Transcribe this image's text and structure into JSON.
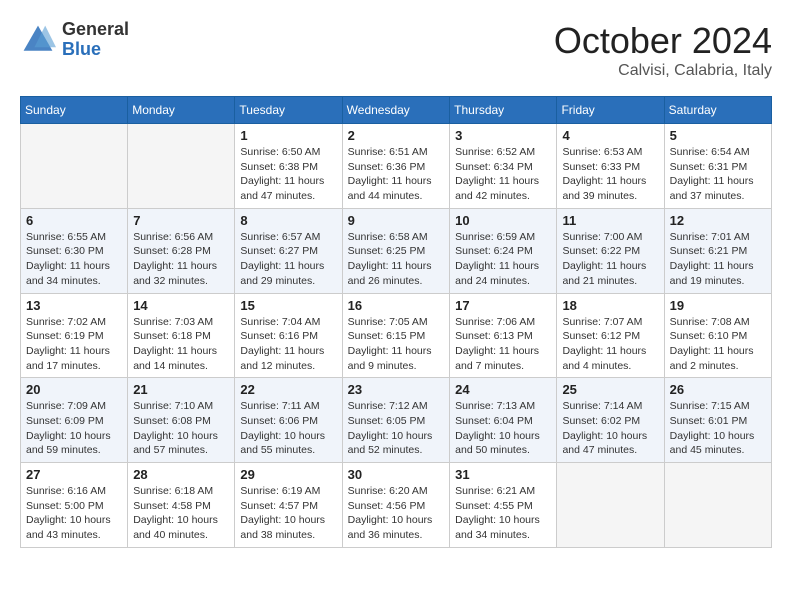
{
  "header": {
    "logo_general": "General",
    "logo_blue": "Blue",
    "month": "October 2024",
    "location": "Calvisi, Calabria, Italy"
  },
  "days_of_week": [
    "Sunday",
    "Monday",
    "Tuesday",
    "Wednesday",
    "Thursday",
    "Friday",
    "Saturday"
  ],
  "weeks": [
    [
      null,
      null,
      {
        "day": "1",
        "sunrise": "6:50 AM",
        "sunset": "6:38 PM",
        "daylight": "11 hours and 47 minutes."
      },
      {
        "day": "2",
        "sunrise": "6:51 AM",
        "sunset": "6:36 PM",
        "daylight": "11 hours and 44 minutes."
      },
      {
        "day": "3",
        "sunrise": "6:52 AM",
        "sunset": "6:34 PM",
        "daylight": "11 hours and 42 minutes."
      },
      {
        "day": "4",
        "sunrise": "6:53 AM",
        "sunset": "6:33 PM",
        "daylight": "11 hours and 39 minutes."
      },
      {
        "day": "5",
        "sunrise": "6:54 AM",
        "sunset": "6:31 PM",
        "daylight": "11 hours and 37 minutes."
      }
    ],
    [
      {
        "day": "6",
        "sunrise": "6:55 AM",
        "sunset": "6:30 PM",
        "daylight": "11 hours and 34 minutes."
      },
      {
        "day": "7",
        "sunrise": "6:56 AM",
        "sunset": "6:28 PM",
        "daylight": "11 hours and 32 minutes."
      },
      {
        "day": "8",
        "sunrise": "6:57 AM",
        "sunset": "6:27 PM",
        "daylight": "11 hours and 29 minutes."
      },
      {
        "day": "9",
        "sunrise": "6:58 AM",
        "sunset": "6:25 PM",
        "daylight": "11 hours and 26 minutes."
      },
      {
        "day": "10",
        "sunrise": "6:59 AM",
        "sunset": "6:24 PM",
        "daylight": "11 hours and 24 minutes."
      },
      {
        "day": "11",
        "sunrise": "7:00 AM",
        "sunset": "6:22 PM",
        "daylight": "11 hours and 21 minutes."
      },
      {
        "day": "12",
        "sunrise": "7:01 AM",
        "sunset": "6:21 PM",
        "daylight": "11 hours and 19 minutes."
      }
    ],
    [
      {
        "day": "13",
        "sunrise": "7:02 AM",
        "sunset": "6:19 PM",
        "daylight": "11 hours and 17 minutes."
      },
      {
        "day": "14",
        "sunrise": "7:03 AM",
        "sunset": "6:18 PM",
        "daylight": "11 hours and 14 minutes."
      },
      {
        "day": "15",
        "sunrise": "7:04 AM",
        "sunset": "6:16 PM",
        "daylight": "11 hours and 12 minutes."
      },
      {
        "day": "16",
        "sunrise": "7:05 AM",
        "sunset": "6:15 PM",
        "daylight": "11 hours and 9 minutes."
      },
      {
        "day": "17",
        "sunrise": "7:06 AM",
        "sunset": "6:13 PM",
        "daylight": "11 hours and 7 minutes."
      },
      {
        "day": "18",
        "sunrise": "7:07 AM",
        "sunset": "6:12 PM",
        "daylight": "11 hours and 4 minutes."
      },
      {
        "day": "19",
        "sunrise": "7:08 AM",
        "sunset": "6:10 PM",
        "daylight": "11 hours and 2 minutes."
      }
    ],
    [
      {
        "day": "20",
        "sunrise": "7:09 AM",
        "sunset": "6:09 PM",
        "daylight": "10 hours and 59 minutes."
      },
      {
        "day": "21",
        "sunrise": "7:10 AM",
        "sunset": "6:08 PM",
        "daylight": "10 hours and 57 minutes."
      },
      {
        "day": "22",
        "sunrise": "7:11 AM",
        "sunset": "6:06 PM",
        "daylight": "10 hours and 55 minutes."
      },
      {
        "day": "23",
        "sunrise": "7:12 AM",
        "sunset": "6:05 PM",
        "daylight": "10 hours and 52 minutes."
      },
      {
        "day": "24",
        "sunrise": "7:13 AM",
        "sunset": "6:04 PM",
        "daylight": "10 hours and 50 minutes."
      },
      {
        "day": "25",
        "sunrise": "7:14 AM",
        "sunset": "6:02 PM",
        "daylight": "10 hours and 47 minutes."
      },
      {
        "day": "26",
        "sunrise": "7:15 AM",
        "sunset": "6:01 PM",
        "daylight": "10 hours and 45 minutes."
      }
    ],
    [
      {
        "day": "27",
        "sunrise": "6:16 AM",
        "sunset": "5:00 PM",
        "daylight": "10 hours and 43 minutes."
      },
      {
        "day": "28",
        "sunrise": "6:18 AM",
        "sunset": "4:58 PM",
        "daylight": "10 hours and 40 minutes."
      },
      {
        "day": "29",
        "sunrise": "6:19 AM",
        "sunset": "4:57 PM",
        "daylight": "10 hours and 38 minutes."
      },
      {
        "day": "30",
        "sunrise": "6:20 AM",
        "sunset": "4:56 PM",
        "daylight": "10 hours and 36 minutes."
      },
      {
        "day": "31",
        "sunrise": "6:21 AM",
        "sunset": "4:55 PM",
        "daylight": "10 hours and 34 minutes."
      },
      null,
      null
    ]
  ],
  "labels": {
    "sunrise_prefix": "Sunrise: ",
    "sunset_prefix": "Sunset: ",
    "daylight_prefix": "Daylight: "
  }
}
